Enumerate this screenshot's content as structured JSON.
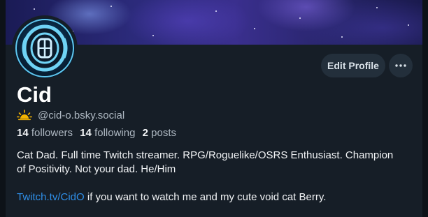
{
  "profile": {
    "display_name": "Cid",
    "handle": "@cid-o.bsky.social",
    "stats": {
      "followers_count": "14",
      "followers_label": "followers",
      "following_count": "14",
      "following_label": "following",
      "posts_count": "2",
      "posts_label": "posts"
    },
    "bio": {
      "line1": "Cat Dad. Full time Twitch streamer. RPG/Roguelike/OSRS Enthusiast. Champion",
      "line2": "of Positivity. Not your dad. He/Him",
      "link_text": "Twitch.tv/CidO",
      "line3_rest": " if you want to watch me and my cute void cat Berry."
    }
  },
  "actions": {
    "edit_profile_label": "Edit Profile",
    "more_icon": "more-horizontal-icon"
  },
  "icons": {
    "handle_badge": "sunrise-icon",
    "avatar_logo": "cid-logo"
  },
  "colors": {
    "background": "#161e27",
    "button_bg": "#232f3b",
    "link": "#2f8fe8",
    "muted_text": "#aeb8c2",
    "badge_yellow": "#f4b400"
  }
}
